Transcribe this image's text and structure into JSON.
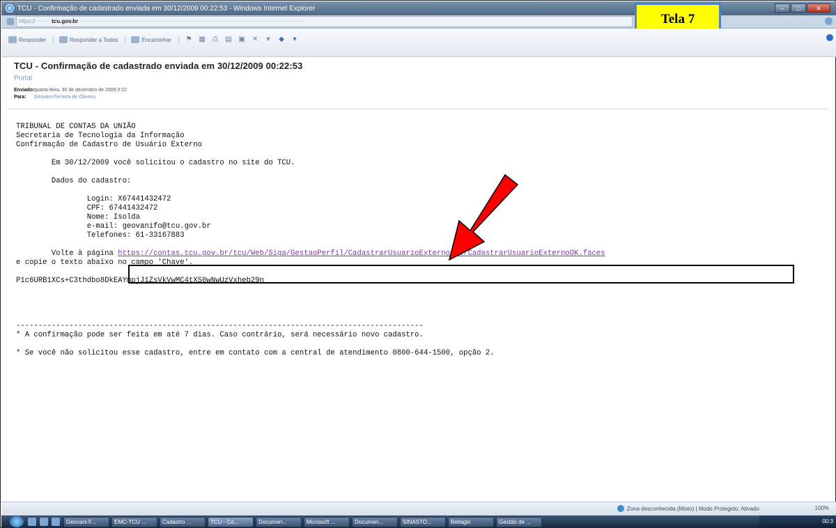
{
  "window": {
    "title": "TCU - Confirmação de cadastrado enviada em 30/12/2009 00:22:53 - Windows Internet Explorer",
    "url_prefix": "https://",
    "url_domain": "tcu.gov.br"
  },
  "annotation": {
    "tela_label": "Tela 7"
  },
  "toolbar": {
    "reply": "Responder",
    "reply_all": "Responder a Todos",
    "forward": "Encaminhar"
  },
  "message": {
    "subject": "TCU - Confirmação de cadastrado enviada em 30/12/2009 00:22:53",
    "folder": "Portal",
    "sent_label": "Enviado:",
    "sent_value": "quarta-feira, 30 de dezembro de 2009 0:22",
    "to_label": "Para:",
    "to_value": "Geovani Ferreira de Oliveira",
    "body": {
      "org": "TRIBUNAL DE CONTAS DA UNIÃO",
      "dept": "Secretaria de Tecnologia da Informação",
      "heading": "Confirmação de Cadastro de Usuário Externo",
      "request_line": "        Em 30/12/2009 você solicitou o cadastro no site do TCU.",
      "data_heading": "        Dados do cadastro:",
      "login": "                Login: X67441432472",
      "cpf": "                CPF: 67441432472",
      "name": "                Nome: Isolda",
      "email": "                e-mail: geovanifo@tcu.gov.br",
      "phone": "                Telefones: 61-33167883",
      "return_prefix": "        Volte à página ",
      "return_link": "https://contas.tcu.gov.br/tcu/Web/Siga/GestaoPerfil/CadastrarUsuarioExterno_v2/CadastrarUsuarioExternoOK.faces",
      "copy_line": "e copie o texto abaixo no campo 'Chave'.",
      "key": "P1c6URB1XCs+C3thdbo8DkEAYmpjJ1ZsVkVwMC4tXS0wNwUzVxheb29n",
      "separator": "--------------------------------------------------------------------------------------------",
      "note1": "* A confirmação pode ser feita em até 7 dias. Caso contrário, será necessário novo cadastro.",
      "note2": "* Se você não solicitou esse cadastro, entre em contato com a central de atendimento 0800-644-1500, opção 2."
    }
  },
  "status": {
    "zone": "Zona desconhecida (Misto) | Modo Protegido: Ativado",
    "zoom": "100%"
  },
  "taskbar": {
    "items": [
      "Geovani F...",
      "EMC-TCU ...",
      "Cadastro ...",
      "TCU - Co...",
      "Documen...",
      "Microsoft ...",
      "Documen...",
      "SINASTO...",
      "Bellagio",
      "Gestão de ..."
    ],
    "clock": "00:3"
  }
}
